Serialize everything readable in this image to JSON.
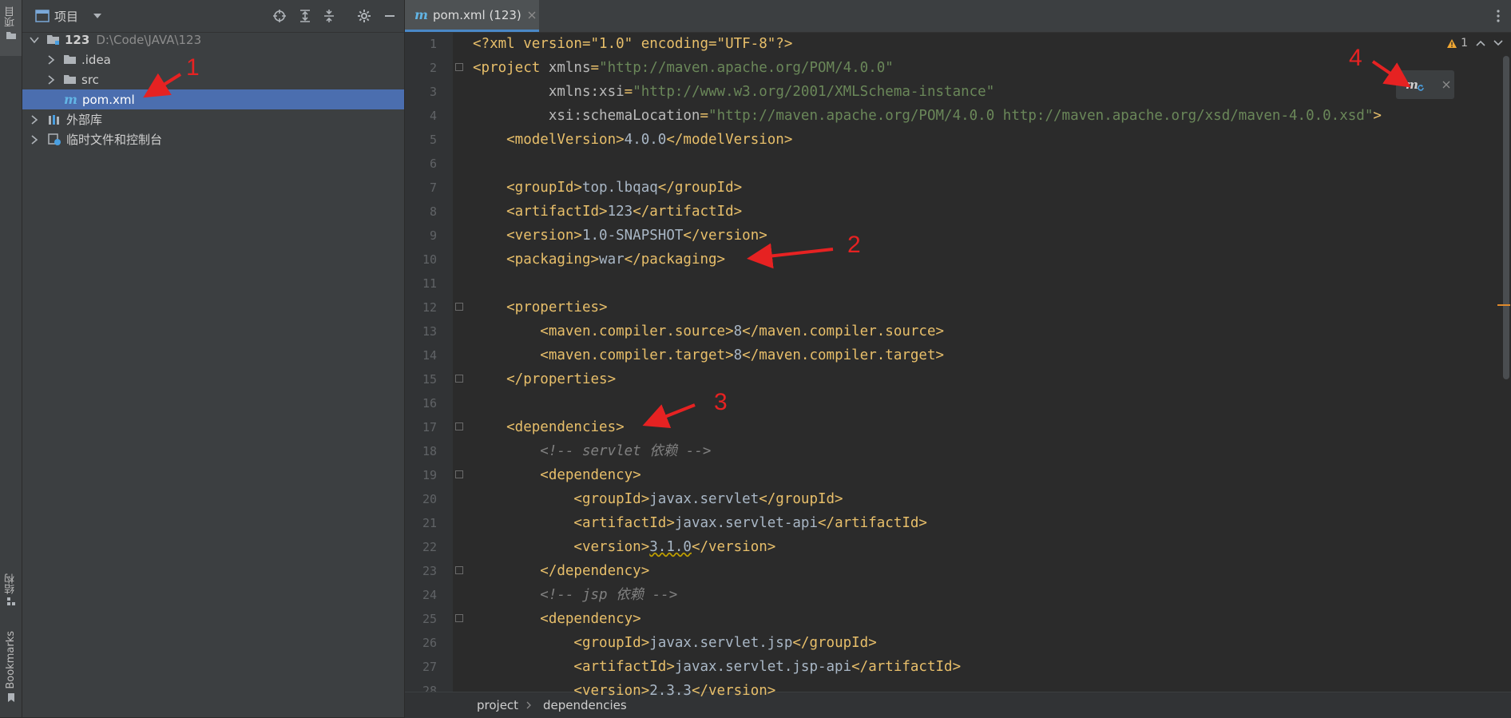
{
  "left_strip": {
    "project_tab": "项目",
    "structure_tab": "结构",
    "bookmarks_tab": "Bookmarks"
  },
  "project_panel": {
    "title": "项目",
    "tree": [
      {
        "label": "123",
        "path": "D:\\Code\\JAVA\\123"
      },
      {
        "label": ".idea"
      },
      {
        "label": "src"
      },
      {
        "label": "pom.xml"
      },
      {
        "label": "外部库"
      },
      {
        "label": "临时文件和控制台"
      }
    ]
  },
  "editor": {
    "tab_label": "pom.xml (123)",
    "maven_logo": "m",
    "warning_count": "1",
    "lines": [
      [
        [
          "t-pi",
          "<?xml version=\"1.0\" encoding=\"UTF-8\"?>"
        ]
      ],
      [
        [
          "t-tag",
          "<project "
        ],
        [
          "t-att",
          "xmlns"
        ],
        [
          "t-tag",
          "="
        ],
        [
          "t-val",
          "\"http://maven.apache.org/POM/4.0.0\""
        ]
      ],
      [
        [
          "t-att",
          "         xmlns:xsi"
        ],
        [
          "t-tag",
          "="
        ],
        [
          "t-val",
          "\"http://www.w3.org/2001/XMLSchema-instance\""
        ]
      ],
      [
        [
          "t-att",
          "         xsi:schemaLocation"
        ],
        [
          "t-tag",
          "="
        ],
        [
          "t-val",
          "\"http://maven.apache.org/POM/4.0.0 http://maven.apache.org/xsd/maven-4.0.0.xsd\""
        ],
        [
          "t-tag",
          ">"
        ]
      ],
      [
        [
          "t-tag",
          "    <modelVersion>"
        ],
        [
          "t-txt",
          "4.0.0"
        ],
        [
          "t-tag",
          "</modelVersion>"
        ]
      ],
      [],
      [
        [
          "t-tag",
          "    <groupId>"
        ],
        [
          "t-txt",
          "top.lbqaq"
        ],
        [
          "t-tag",
          "</groupId>"
        ]
      ],
      [
        [
          "t-tag",
          "    <artifactId>"
        ],
        [
          "t-txt",
          "123"
        ],
        [
          "t-tag",
          "</artifactId>"
        ]
      ],
      [
        [
          "t-tag",
          "    <version>"
        ],
        [
          "t-txt",
          "1.0-SNAPSHOT"
        ],
        [
          "t-tag",
          "</version>"
        ]
      ],
      [
        [
          "t-tag",
          "    <packaging>"
        ],
        [
          "t-txt",
          "war"
        ],
        [
          "t-tag",
          "</packaging>"
        ]
      ],
      [],
      [
        [
          "t-tag",
          "    <properties>"
        ]
      ],
      [
        [
          "t-tag",
          "        <maven.compiler.source>"
        ],
        [
          "t-txt",
          "8"
        ],
        [
          "t-tag",
          "</maven.compiler.source>"
        ]
      ],
      [
        [
          "t-tag",
          "        <maven.compiler.target>"
        ],
        [
          "t-txt",
          "8"
        ],
        [
          "t-tag",
          "</maven.compiler.target>"
        ]
      ],
      [
        [
          "t-tag",
          "    </properties>"
        ]
      ],
      [],
      [
        [
          "t-tag",
          "    <dependencies>"
        ]
      ],
      [
        [
          "t-cmt",
          "        <!-- servlet 依赖 -->"
        ]
      ],
      [
        [
          "t-tag",
          "        <dependency>"
        ]
      ],
      [
        [
          "t-tag",
          "            <groupId>"
        ],
        [
          "t-txt",
          "javax.servlet"
        ],
        [
          "t-tag",
          "</groupId>"
        ]
      ],
      [
        [
          "t-tag",
          "            <artifactId>"
        ],
        [
          "t-txt",
          "javax.servlet-api"
        ],
        [
          "t-tag",
          "</artifactId>"
        ]
      ],
      [
        [
          "t-tag",
          "            <version>"
        ],
        [
          "t-txt sq",
          "3.1.0"
        ],
        [
          "t-tag",
          "</version>"
        ]
      ],
      [
        [
          "t-tag",
          "        </dependency>"
        ]
      ],
      [
        [
          "t-cmt",
          "        <!-- jsp 依赖 -->"
        ]
      ],
      [
        [
          "t-tag",
          "        <dependency>"
        ]
      ],
      [
        [
          "t-tag",
          "            <groupId>"
        ],
        [
          "t-txt",
          "javax.servlet.jsp"
        ],
        [
          "t-tag",
          "</groupId>"
        ]
      ],
      [
        [
          "t-tag",
          "            <artifactId>"
        ],
        [
          "t-txt",
          "javax.servlet.jsp-api"
        ],
        [
          "t-tag",
          "</artifactId>"
        ]
      ],
      [
        [
          "t-tag",
          "            <version>"
        ],
        [
          "t-txt",
          "2.3.3"
        ],
        [
          "t-tag",
          "</version>"
        ]
      ]
    ]
  },
  "breadcrumb": [
    "project",
    "dependencies"
  ],
  "annotations": [
    "1",
    "2",
    "3",
    "4"
  ],
  "colors": {
    "accent": "#4b6eaf",
    "annotation": "#e62222",
    "maven": "#62b5e5"
  }
}
